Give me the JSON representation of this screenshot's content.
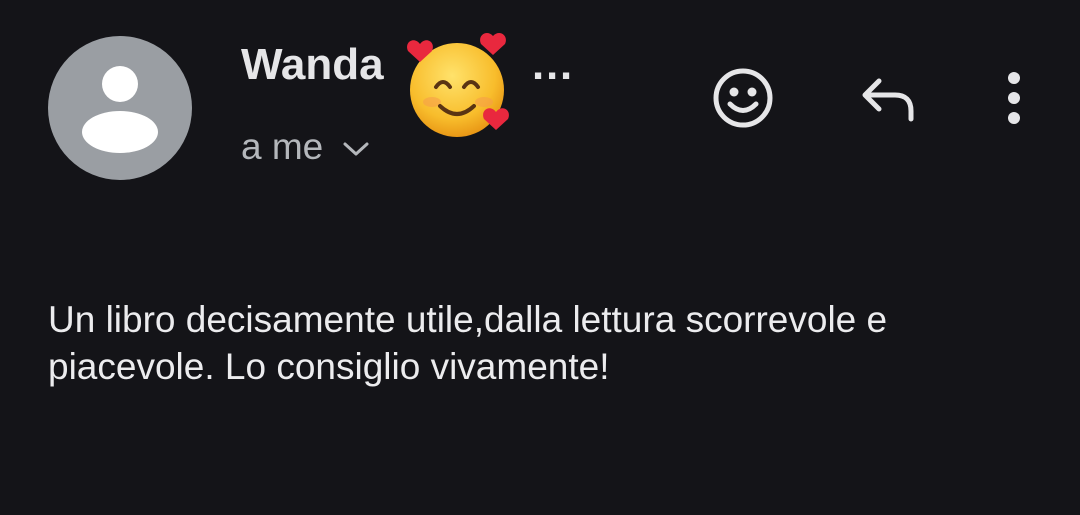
{
  "message": {
    "sender_name": "Wanda",
    "sender_name_suffix": "…",
    "sender_emoji_icon": "smiling-face-with-hearts-icon",
    "recipient_label": "a me",
    "body": "Un libro decisamente utile,dalla lettura scorrevole e piacevole. Lo consiglio vivamente!"
  },
  "actions": [
    {
      "icon": "smiley-reaction-icon"
    },
    {
      "icon": "reply-arrow-icon"
    },
    {
      "icon": "more-vertical-icon"
    }
  ],
  "colors": {
    "background": "#141418",
    "avatar_bg": "#9a9ea3",
    "text_primary": "#e6e6e8",
    "text_secondary": "#b4b7bb"
  }
}
